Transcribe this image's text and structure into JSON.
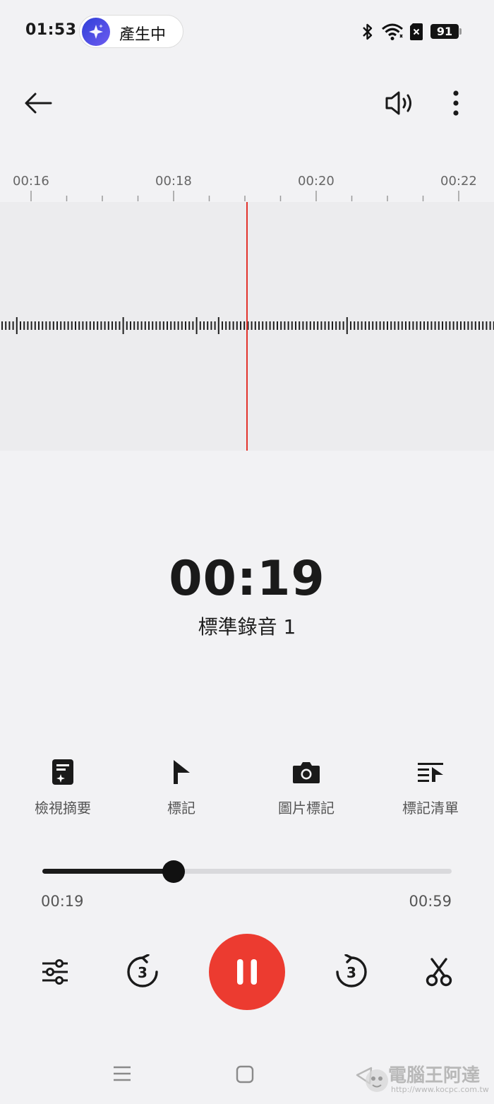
{
  "status_bar": {
    "time": "01:53",
    "pill_label": "產生中",
    "battery": "91",
    "icons": [
      "bluetooth-icon",
      "wifi-icon",
      "sim-off-icon",
      "battery-icon"
    ]
  },
  "toolbar": {
    "icons": [
      "back-arrow-icon",
      "speaker-icon",
      "more-vertical-icon"
    ]
  },
  "ruler": {
    "labels": [
      "00:16",
      "00:18",
      "00:20",
      "00:22"
    ]
  },
  "recording": {
    "elapsed": "00:19",
    "name": "標準錄音 1"
  },
  "actions": [
    {
      "label": "檢視摘要",
      "icon": "summary-icon"
    },
    {
      "label": "標記",
      "icon": "flag-icon"
    },
    {
      "label": "圖片標記",
      "icon": "camera-icon"
    },
    {
      "label": "標記清單",
      "icon": "mark-list-icon"
    }
  ],
  "progress": {
    "current": "00:19",
    "total": "00:59",
    "fraction": 0.32
  },
  "controls": {
    "icons": [
      "equalizer-icon",
      "rewind-3-icon",
      "pause-icon",
      "forward-3-icon",
      "scissors-icon"
    ],
    "rewind_label": "3",
    "forward_label": "3"
  },
  "colors": {
    "accent": "#ec3b30",
    "playhead": "#e2332b"
  },
  "watermark": {
    "text": "電腦王阿達",
    "url": "http://www.kocpc.com.tw"
  }
}
